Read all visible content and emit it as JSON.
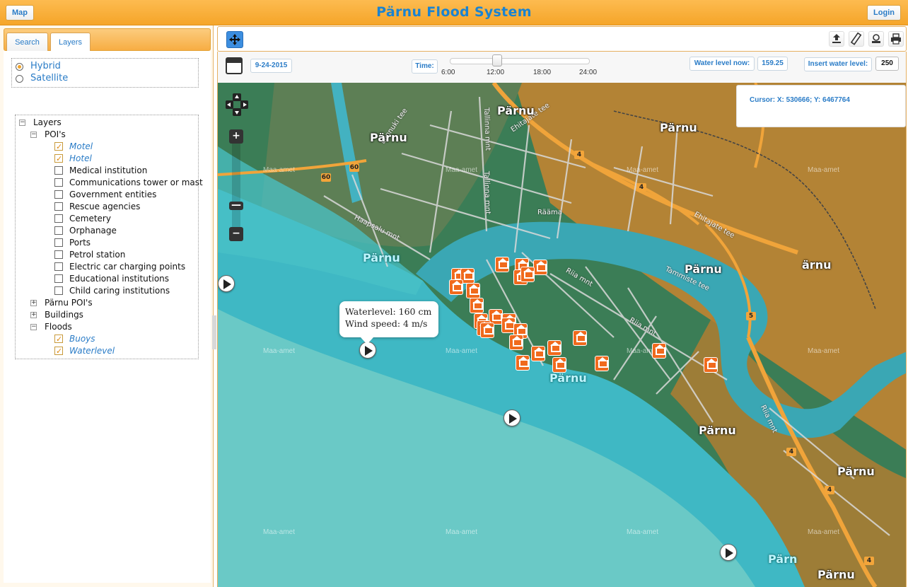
{
  "header": {
    "map_label": "Map",
    "title": "Pärnu Flood System",
    "login_label": "Login"
  },
  "sidebar": {
    "tabs": [
      "Search",
      "Layers"
    ],
    "active_tab": "Layers",
    "basemaps": [
      {
        "label": "Hybrid",
        "selected": true
      },
      {
        "label": "Satellite",
        "selected": false
      }
    ],
    "tree": {
      "root": "Layers",
      "pois_group": "POI's",
      "pois": [
        {
          "label": "Motel",
          "checked": true
        },
        {
          "label": "Hotel",
          "checked": true
        },
        {
          "label": "Medical institution",
          "checked": false
        },
        {
          "label": "Communications tower or mast",
          "checked": false
        },
        {
          "label": "Government entities",
          "checked": false
        },
        {
          "label": "Rescue agencies",
          "checked": false
        },
        {
          "label": "Cemetery",
          "checked": false
        },
        {
          "label": "Orphanage",
          "checked": false
        },
        {
          "label": "Ports",
          "checked": false
        },
        {
          "label": "Petrol station",
          "checked": false
        },
        {
          "label": "Electric car charging points",
          "checked": false
        },
        {
          "label": "Educational institutions",
          "checked": false
        },
        {
          "label": "Child caring institutions",
          "checked": false
        }
      ],
      "parnu_pois": "Pärnu POI's",
      "buildings": "Buildings",
      "floods_group": "Floods",
      "floods": [
        {
          "label": "Buoys",
          "checked": true
        },
        {
          "label": "Waterlevel",
          "checked": true
        }
      ]
    }
  },
  "toolbar": {
    "icons": [
      "pan-icon",
      "upload-icon",
      "ruler-icon",
      "stamp-icon",
      "print-icon"
    ]
  },
  "timebar": {
    "date_value": "9-24-2015",
    "time_label": "Time:",
    "slider_value_fraction": 0.33,
    "ticks": [
      "6:00",
      "12:00",
      "18:00",
      "24:00"
    ],
    "water_level_label": "Water level now:",
    "water_level_value": "159.25",
    "insert_label": "Insert water level:",
    "insert_value": "250"
  },
  "map": {
    "cursor_text": "Cursor: X: 530666; Y: 6467764",
    "popup": {
      "line1": "Waterlevel: 160 cm",
      "line2": "Wind speed: 4 m/s"
    },
    "place_labels": [
      "Pärnu",
      "Pärnu",
      "Pärnu",
      "Pärnu",
      "Pärnu",
      "ärnu",
      "Pärnu",
      "Pärnu",
      "Pärnu",
      "Pärnu",
      "Pärn",
      "Pärnu"
    ],
    "watermark": "Maa-amet",
    "roads": [
      "Tallinna mnt",
      "Tallinna mnt",
      "Riiamaa",
      "Rääma",
      "Haapsalu mnt",
      "Riia mnt",
      "Riia mnt",
      "Tammiste tee",
      "Ehitajate tee",
      "Ehitajate tee",
      "Lennuki tee",
      "Tulbi",
      "Riia mnt"
    ],
    "route_shields": [
      "60",
      "60",
      "4",
      "4",
      "5",
      "4",
      "4",
      "4"
    ],
    "colors": {
      "water": "#3fb8c4",
      "land": "#2f7d5a",
      "farmland": "#d98a2a",
      "road_major": "#f0a43a",
      "marker": "#f06a1d"
    }
  }
}
